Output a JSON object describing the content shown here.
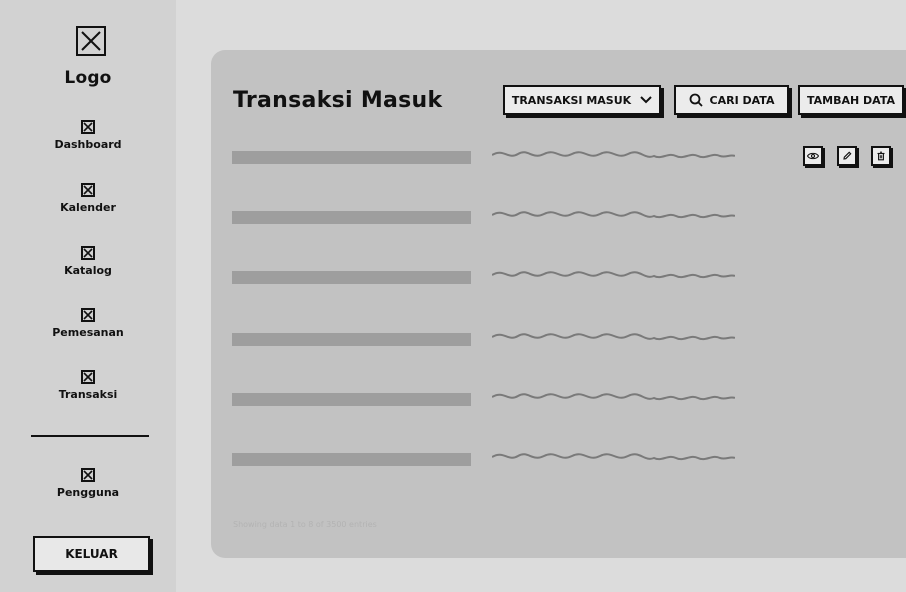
{
  "sidebar": {
    "logo_text": "Logo",
    "items": [
      {
        "label": "Dashboard"
      },
      {
        "label": "Kalender"
      },
      {
        "label": "Katalog"
      },
      {
        "label": "Pemesanan"
      },
      {
        "label": "Transaksi"
      }
    ],
    "bottom_item": {
      "label": "Pengguna"
    },
    "logout_label": "KELUAR"
  },
  "main": {
    "title": "Transaksi Masuk",
    "dropdown_label": "TRANSAKSI MASUK",
    "search_label": "CARI DATA",
    "add_label": "TAMBAH DATA",
    "rows_count": 6,
    "footer_note": "Showing data 1 to 8 of  3500 entries",
    "row_actions": [
      "eye-icon",
      "pencil-icon",
      "trash-icon"
    ]
  },
  "colors": {
    "page_bg": "#dcdcdc",
    "sidebar_bg": "#d2d2d2",
    "panel_bg": "#c2c2c2",
    "placeholder_bar": "#9e9e9e",
    "squiggle": "#7a7a7a",
    "button_bg": "#ececec",
    "border": "#111111"
  }
}
